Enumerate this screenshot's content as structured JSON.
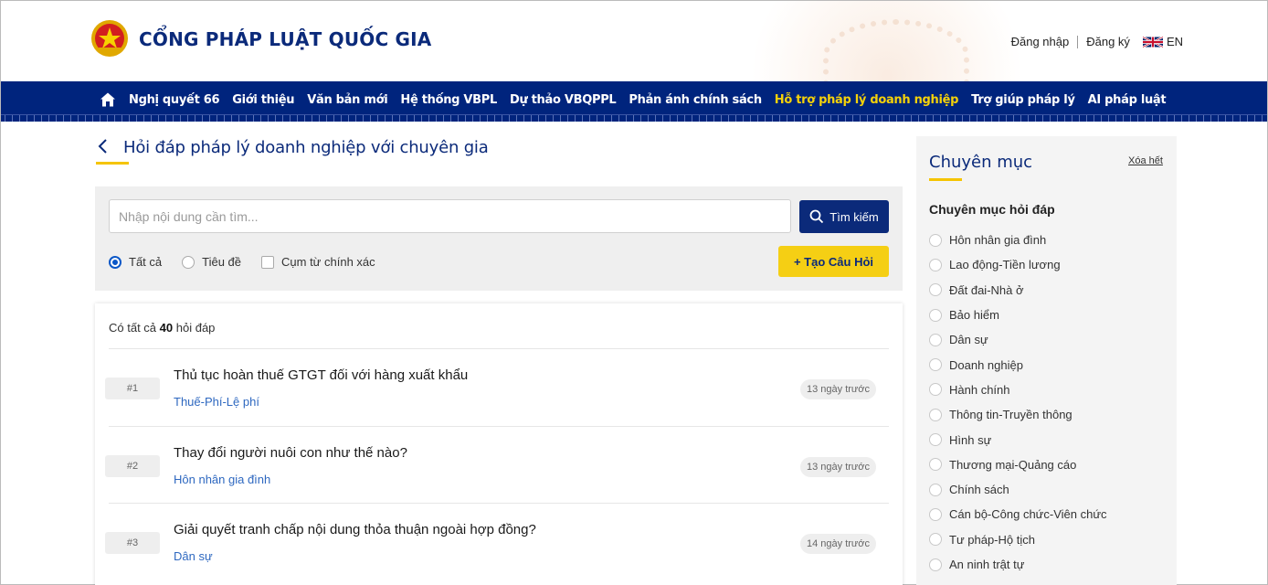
{
  "header": {
    "site_title": "CỔNG PHÁP LUẬT QUỐC GIA",
    "login": "Đăng nhập",
    "register": "Đăng ký",
    "lang": "EN"
  },
  "nav": {
    "items": [
      {
        "label": "Nghị quyết 66"
      },
      {
        "label": "Giới thiệu"
      },
      {
        "label": "Văn bản mới"
      },
      {
        "label": "Hệ thống VBPL"
      },
      {
        "label": "Dự thảo VBQPPL"
      },
      {
        "label": "Phản ánh chính sách"
      },
      {
        "label": "Hỗ trợ pháp lý doanh nghiệp",
        "active": true
      },
      {
        "label": "Trợ giúp pháp lý"
      },
      {
        "label": "AI pháp luật"
      }
    ]
  },
  "page": {
    "title": "Hỏi đáp pháp lý doanh nghiệp với chuyên gia"
  },
  "search": {
    "placeholder": "Nhập nội dung cần tìm...",
    "button": "Tìm kiếm",
    "filters": {
      "all": "Tất cả",
      "title": "Tiêu đề",
      "exact": "Cụm từ chính xác"
    },
    "create_button": "+ Tạo Câu Hỏi"
  },
  "results": {
    "count_prefix": "Có tất cả",
    "count": "40",
    "count_suffix": "hỏi đáp",
    "items": [
      {
        "num": "#1",
        "title": "Thủ tục hoàn thuế GTGT đối với hàng xuất khẩu",
        "category": "Thuế-Phí-Lệ phí",
        "time": "13 ngày trước"
      },
      {
        "num": "#2",
        "title": "Thay đổi người nuôi con như thế nào?",
        "category": "Hôn nhân gia đình",
        "time": "13 ngày trước"
      },
      {
        "num": "#3",
        "title": "Giải quyết tranh chấp nội dung thỏa thuận ngoài hợp đồng?",
        "category": "Dân sự",
        "time": "14 ngày trước"
      }
    ]
  },
  "sidebar": {
    "title": "Chuyên mục",
    "clear": "Xóa hết",
    "subtitle": "Chuyên mục hỏi đáp",
    "categories": [
      "Hôn nhân gia đình",
      "Lao động-Tiền lương",
      "Đất đai-Nhà ở",
      "Bảo hiểm",
      "Dân sự",
      "Doanh nghiệp",
      "Hành chính",
      "Thông tin-Truyền thông",
      "Hình sự",
      "Thương mại-Quảng cáo",
      "Chính sách",
      "Cán bộ-Công chức-Viên chức",
      "Tư pháp-Hộ tịch",
      "An ninh trật tự"
    ]
  },
  "colors": {
    "primary": "#0b2a7a",
    "nav_bg": "#00247d",
    "accent": "#f5cf14",
    "link": "#2e68c0"
  }
}
